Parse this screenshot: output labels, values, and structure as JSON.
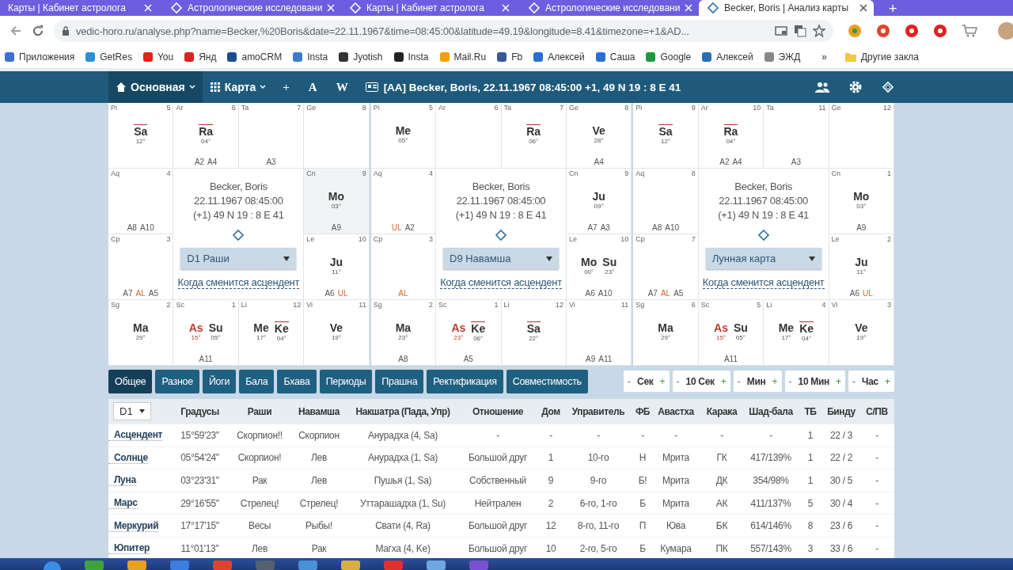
{
  "browser": {
    "tabs": [
      {
        "title": "Карты | Кабинет астролога",
        "selected": false,
        "icon": false
      },
      {
        "title": "Астрологические исследовани",
        "selected": false,
        "icon": true
      },
      {
        "title": "Карты | Кабинет астролога",
        "selected": false,
        "icon": true
      },
      {
        "title": "Астрологические исследовани",
        "selected": false,
        "icon": true
      },
      {
        "title": "Becker, Boris | Анализ карты",
        "selected": true,
        "icon": true
      }
    ],
    "new_tab": "+",
    "address": "vedic-horo.ru/analyse.php?name=Becker,%20Boris&date=22.11.1967&time=08:45:00&latitude=49.19&longitude=8.41&timezone=+1&AD...",
    "bookmarks": [
      {
        "label": "Приложения",
        "color": "#3b6fd8"
      },
      {
        "label": "GetRes",
        "color": "#2a8fd6"
      },
      {
        "label": "You",
        "color": "#e62117"
      },
      {
        "label": "Янд",
        "color": "#e02020"
      },
      {
        "label": "amoCRM",
        "color": "#1a4e8f"
      },
      {
        "label": "Insta",
        "color": "#3a7bd5"
      },
      {
        "label": "Jyotish",
        "color": "#333333"
      },
      {
        "label": "Insta",
        "color": "#222222"
      },
      {
        "label": "Mail.Ru",
        "color": "#f0a000"
      },
      {
        "label": "Fb",
        "color": "#3b5998"
      },
      {
        "label": "Алексей",
        "color": "#2a6fd6"
      },
      {
        "label": "Саша",
        "color": "#2a6fd6"
      },
      {
        "label": "Google",
        "color": "#1a9c3e"
      },
      {
        "label": "Алексей",
        "color": "#2a6eb0"
      },
      {
        "label": "ЭЖД",
        "color": "#888888"
      }
    ],
    "bookmarks_more": "»",
    "other_bookmarks": "Другие закла"
  },
  "navbar": {
    "menus": [
      {
        "label": "Основная",
        "selected": true,
        "kind": "home"
      },
      {
        "label": "Карта",
        "selected": false,
        "kind": "grid"
      }
    ],
    "buttons": [
      "+",
      "A",
      "W"
    ],
    "title": "[AA] Becker, Boris, 22.11.1967 08:45:00 +1, 49 N 19 : 8 E 41"
  },
  "charts": [
    {
      "center": {
        "name": "Becker, Boris",
        "datetime": "22.11.1967 08:45:00",
        "coordinates": "(+1) 49 N 19 : 8 E 41",
        "select": "D1 Раши",
        "link": "Когда сменится асцендент"
      },
      "cells": [
        {
          "sign": "Pi",
          "house": "5",
          "highlighted": false,
          "planets": [
            {
              "name": "Sa",
              "degree": "12°",
              "retrograde": true,
              "kind": "planet"
            }
          ]
        },
        {
          "sign": "Ar",
          "house": "6",
          "highlighted": false,
          "planets": [
            {
              "name": "Ra",
              "degree": "04°",
              "retrograde": true,
              "kind": "planet"
            }
          ],
          "labels": [
            {
              "text": "A2",
              "kind": "arudha"
            },
            {
              "text": "A4",
              "kind": "arudha"
            }
          ]
        },
        {
          "sign": "Ta",
          "house": "7",
          "highlighted": false,
          "labels": [
            {
              "text": "A3",
              "kind": "arudha"
            }
          ]
        },
        {
          "sign": "Ge",
          "house": "8",
          "highlighted": false
        },
        {
          "sign": "Aq",
          "house": "4",
          "highlighted": false,
          "labels": [
            {
              "text": "A8",
              "kind": "arudha"
            },
            {
              "text": "A10",
              "kind": "arudha"
            }
          ]
        },
        {
          "sign": "Cn",
          "house": "9",
          "highlighted": true,
          "planets": [
            {
              "name": "Mo",
              "degree": "03°",
              "retrograde": false,
              "kind": "planet"
            }
          ],
          "labels": [
            {
              "text": "A9",
              "kind": "arudha"
            }
          ]
        },
        {
          "sign": "Cp",
          "house": "3",
          "highlighted": false,
          "labels": [
            {
              "text": "A7",
              "kind": "arudha"
            },
            {
              "text": "AL",
              "kind": "lagna"
            },
            {
              "text": "A5",
              "kind": "arudha"
            }
          ]
        },
        {
          "sign": "Le",
          "house": "10",
          "highlighted": false,
          "planets": [
            {
              "name": "Ju",
              "degree": "11°",
              "retrograde": false,
              "kind": "planet"
            }
          ],
          "labels": [
            {
              "text": "A6",
              "kind": "arudha"
            },
            {
              "text": "UL",
              "kind": "lagna"
            }
          ]
        },
        {
          "sign": "Sg",
          "house": "2",
          "highlighted": false,
          "planets": [
            {
              "name": "Ma",
              "degree": "29°",
              "retrograde": false,
              "kind": "planet"
            }
          ]
        },
        {
          "sign": "Sc",
          "house": "1",
          "highlighted": false,
          "planets": [
            {
              "name": "As",
              "degree": "15°",
              "retrograde": false,
              "kind": "ascendant"
            },
            {
              "name": "Su",
              "degree": "05°",
              "retrograde": false,
              "kind": "planet"
            }
          ],
          "labels": [
            {
              "text": "A11",
              "kind": "arudha"
            }
          ]
        },
        {
          "sign": "Li",
          "house": "12",
          "highlighted": false,
          "planets": [
            {
              "name": "Me",
              "degree": "17°",
              "retrograde": false,
              "kind": "planet"
            },
            {
              "name": "Ke",
              "degree": "04°",
              "retrograde": true,
              "kind": "planet"
            }
          ]
        },
        {
          "sign": "Vi",
          "house": "11",
          "highlighted": false,
          "planets": [
            {
              "name": "Ve",
              "degree": "19°",
              "retrograde": false,
              "kind": "planet"
            }
          ]
        }
      ]
    },
    {
      "center": {
        "name": "Becker, Boris",
        "datetime": "22.11.1967 08:45:00",
        "coordinates": "(+1) 49 N 19 : 8 E 41",
        "select": "D9 Навамша",
        "link": "Когда сменится асцендент"
      },
      "cells": [
        {
          "sign": "Pi",
          "house": "5",
          "highlighted": false,
          "planets": [
            {
              "name": "Me",
              "degree": "05°",
              "retrograde": false,
              "kind": "planet"
            }
          ]
        },
        {
          "sign": "Ar",
          "house": "6",
          "highlighted": false
        },
        {
          "sign": "Ta",
          "house": "7",
          "highlighted": false,
          "planets": [
            {
              "name": "Ra",
              "degree": "06°",
              "retrograde": true,
              "kind": "planet"
            }
          ]
        },
        {
          "sign": "Ge",
          "house": "8",
          "highlighted": false,
          "planets": [
            {
              "name": "Ve",
              "degree": "28°",
              "retrograde": false,
              "kind": "planet"
            }
          ],
          "labels": [
            {
              "text": "A4",
              "kind": "arudha"
            }
          ]
        },
        {
          "sign": "Aq",
          "house": "4",
          "highlighted": false,
          "labels": [
            {
              "text": "UL",
              "kind": "lagna"
            },
            {
              "text": "A2",
              "kind": "arudha"
            }
          ]
        },
        {
          "sign": "Cn",
          "house": "9",
          "highlighted": false,
          "planets": [
            {
              "name": "Ju",
              "degree": "09°",
              "retrograde": false,
              "kind": "planet"
            }
          ],
          "labels": [
            {
              "text": "A7",
              "kind": "arudha"
            },
            {
              "text": "A3",
              "kind": "arudha"
            }
          ]
        },
        {
          "sign": "Cp",
          "house": "3",
          "highlighted": false,
          "labels": [
            {
              "text": "AL",
              "kind": "lagna"
            }
          ]
        },
        {
          "sign": "Le",
          "house": "10",
          "highlighted": false,
          "planets": [
            {
              "name": "Mo",
              "degree": "00°",
              "retrograde": false,
              "kind": "planet"
            },
            {
              "name": "Su",
              "degree": "23°",
              "retrograde": false,
              "kind": "planet"
            }
          ],
          "labels": [
            {
              "text": "A6",
              "kind": "arudha"
            },
            {
              "text": "A10",
              "kind": "arudha"
            }
          ]
        },
        {
          "sign": "Sg",
          "house": "2",
          "highlighted": false,
          "planets": [
            {
              "name": "Ma",
              "degree": "23°",
              "retrograde": false,
              "kind": "planet"
            }
          ],
          "labels": [
            {
              "text": "A8",
              "kind": "arudha"
            }
          ]
        },
        {
          "sign": "Sc",
          "house": "1",
          "highlighted": false,
          "planets": [
            {
              "name": "As",
              "degree": "23°",
              "retrograde": false,
              "kind": "ascendant"
            },
            {
              "name": "Ke",
              "degree": "06°",
              "retrograde": true,
              "kind": "planet"
            }
          ],
          "labels": [
            {
              "text": "A5",
              "kind": "arudha"
            }
          ]
        },
        {
          "sign": "Li",
          "house": "12",
          "highlighted": false,
          "planets": [
            {
              "name": "Sa",
              "degree": "22°",
              "retrograde": true,
              "kind": "planet"
            }
          ]
        },
        {
          "sign": "Vi",
          "house": "11",
          "highlighted": false,
          "labels": [
            {
              "text": "A9",
              "kind": "arudha"
            },
            {
              "text": "A11",
              "kind": "arudha"
            }
          ]
        }
      ]
    },
    {
      "center": {
        "name": "Becker, Boris",
        "datetime": "22.11.1967 08:45:00",
        "coordinates": "(+1) 49 N 19 : 8 E 41",
        "select": "Лунная карта",
        "link": "Когда сменится асцендент"
      },
      "cells": [
        {
          "sign": "Pi",
          "house": "9",
          "highlighted": false,
          "planets": [
            {
              "name": "Sa",
              "degree": "12°",
              "retrograde": true,
              "kind": "planet"
            }
          ]
        },
        {
          "sign": "Ar",
          "house": "10",
          "highlighted": false,
          "planets": [
            {
              "name": "Ra",
              "degree": "04°",
              "retrograde": true,
              "kind": "planet"
            }
          ],
          "labels": [
            {
              "text": "A2",
              "kind": "arudha"
            },
            {
              "text": "A4",
              "kind": "arudha"
            }
          ]
        },
        {
          "sign": "Ta",
          "house": "11",
          "highlighted": false,
          "labels": [
            {
              "text": "A3",
              "kind": "arudha"
            }
          ]
        },
        {
          "sign": "Ge",
          "house": "12",
          "highlighted": false
        },
        {
          "sign": "Aq",
          "house": "8",
          "highlighted": false,
          "labels": [
            {
              "text": "A8",
              "kind": "arudha"
            },
            {
              "text": "A10",
              "kind": "arudha"
            }
          ]
        },
        {
          "sign": "Cn",
          "house": "1",
          "highlighted": false,
          "planets": [
            {
              "name": "Mo",
              "degree": "03°",
              "retrograde": false,
              "kind": "planet"
            }
          ],
          "labels": [
            {
              "text": "A9",
              "kind": "arudha"
            }
          ]
        },
        {
          "sign": "Cp",
          "house": "7",
          "highlighted": false,
          "labels": [
            {
              "text": "A7",
              "kind": "arudha"
            },
            {
              "text": "AL",
              "kind": "lagna"
            },
            {
              "text": "A5",
              "kind": "arudha"
            }
          ]
        },
        {
          "sign": "Le",
          "house": "2",
          "highlighted": false,
          "planets": [
            {
              "name": "Ju",
              "degree": "11°",
              "retrograde": false,
              "kind": "planet"
            }
          ],
          "labels": [
            {
              "text": "A6",
              "kind": "arudha"
            },
            {
              "text": "UL",
              "kind": "lagna"
            }
          ]
        },
        {
          "sign": "Sg",
          "house": "6",
          "highlighted": false,
          "planets": [
            {
              "name": "Ma",
              "degree": "29°",
              "retrograde": false,
              "kind": "planet"
            }
          ]
        },
        {
          "sign": "Sc",
          "house": "5",
          "highlighted": false,
          "planets": [
            {
              "name": "As",
              "degree": "15°",
              "retrograde": false,
              "kind": "ascendant"
            },
            {
              "name": "Su",
              "degree": "05°",
              "retrograde": false,
              "kind": "planet"
            }
          ],
          "labels": [
            {
              "text": "A11",
              "kind": "arudha"
            }
          ]
        },
        {
          "sign": "Li",
          "house": "4",
          "highlighted": false,
          "planets": [
            {
              "name": "Me",
              "degree": "17°",
              "retrograde": false,
              "kind": "planet"
            },
            {
              "name": "Ke",
              "degree": "04°",
              "retrograde": true,
              "kind": "planet"
            }
          ]
        },
        {
          "sign": "Vi",
          "house": "3",
          "highlighted": false,
          "planets": [
            {
              "name": "Ve",
              "degree": "19°",
              "retrograde": false,
              "kind": "planet"
            }
          ]
        }
      ]
    }
  ],
  "tabs": [
    {
      "label": "Общее",
      "selected": true
    },
    {
      "label": "Разное",
      "selected": false
    },
    {
      "label": "Йоги",
      "selected": false
    },
    {
      "label": "Бала",
      "selected": false
    },
    {
      "label": "Бхава",
      "selected": false
    },
    {
      "label": "Периоды",
      "selected": false
    },
    {
      "label": "Прашна",
      "selected": false
    },
    {
      "label": "Ректификация",
      "selected": false
    },
    {
      "label": "Совместимость",
      "selected": false
    }
  ],
  "time_steppers": [
    {
      "minus": "-",
      "label": "Сек",
      "plus": "+"
    },
    {
      "minus": "-",
      "label": "10 Сек",
      "plus": "+"
    },
    {
      "minus": "-",
      "label": "Мин",
      "plus": "+"
    },
    {
      "minus": "-",
      "label": "10 Мин",
      "plus": "+"
    },
    {
      "minus": "-",
      "label": "Час",
      "plus": "+"
    }
  ],
  "table": {
    "chart_select": "D1",
    "columns": [
      "Градусы",
      "Раши",
      "Навамша",
      "Накшатра (Пада, Упр)",
      "Отношение",
      "Дом",
      "Управитель",
      "ФБ",
      "Авастха",
      "Карака",
      "Шад-бала",
      "ТБ",
      "Бинду",
      "С/ПВ"
    ],
    "rows": [
      {
        "name": "Асцендент",
        "cells": [
          "15°59'23''",
          "Скорпион!!",
          "Скорпион",
          "Анурадха (4, Sa)",
          "-",
          "-",
          "-",
          "-",
          "-",
          "-",
          "-",
          "1",
          "22 / 3",
          "-"
        ]
      },
      {
        "name": "Солнце",
        "cells": [
          "05°54'24''",
          "Скорпион!",
          "Лев",
          "Анурадха (1, Sa)",
          "Большой друг",
          "1",
          "10-го",
          "Н",
          "Мрита",
          "ГК",
          "417/139%",
          "1",
          "22 / 2",
          "-"
        ]
      },
      {
        "name": "Луна",
        "cells": [
          "03°23'31''",
          "Рак",
          "Лев",
          "Пушья (1, Sa)",
          "Собственный",
          "9",
          "9-го",
          "Б!",
          "Мрита",
          "ДК",
          "354/98%",
          "1",
          "30 / 5",
          "-"
        ]
      },
      {
        "name": "Марс",
        "cells": [
          "29°16'55''",
          "Стрелец!",
          "Стрелец!",
          "Уттарашадха (1, Su)",
          "Нейтрален",
          "2",
          "6-го, 1-го",
          "Б",
          "Мрита",
          "АК",
          "411/137%",
          "5",
          "30 / 4",
          "-"
        ]
      },
      {
        "name": "Меркурий",
        "cells": [
          "17°17'15''",
          "Весы",
          "Рыбы!",
          "Свати (4, Ra)",
          "Большой друг",
          "12",
          "8-го, 11-го",
          "П",
          "Юва",
          "БК",
          "614/146%",
          "8",
          "23 / 6",
          "-"
        ]
      },
      {
        "name": "Юпитер",
        "cells": [
          "11°01'13''",
          "Лев",
          "Рак",
          "Магха (4, Ke)",
          "Большой друг",
          "10",
          "2-го, 5-го",
          "Б",
          "Кумара",
          "ПК",
          "557/143%",
          "3",
          "33 / 6",
          "-"
        ]
      }
    ]
  }
}
